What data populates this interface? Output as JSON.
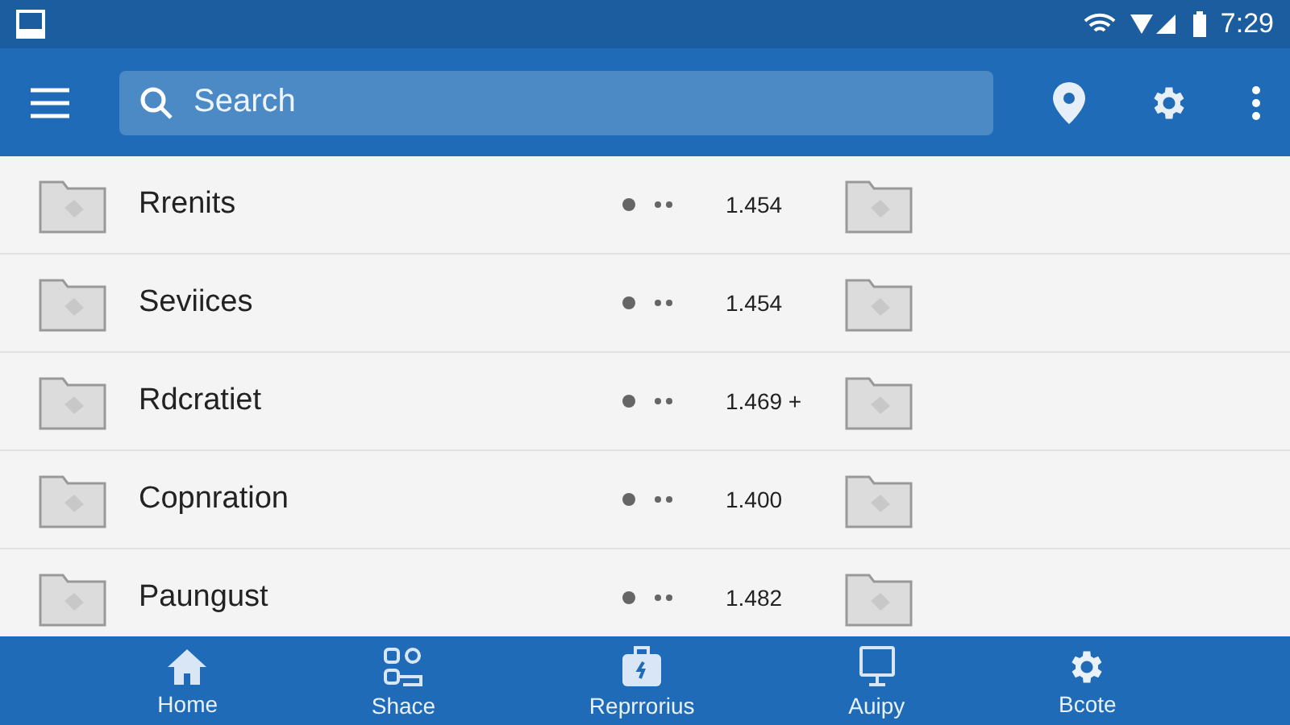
{
  "status_bar": {
    "time": "7:29"
  },
  "app_bar": {
    "search": {
      "placeholder": "Search"
    }
  },
  "rows": [
    {
      "name": "Rrenits",
      "number": "1.454"
    },
    {
      "name": "Seviices",
      "number": "1.454"
    },
    {
      "name": "Rdcratiet",
      "number": "1.469",
      "extra": "+"
    },
    {
      "name": "Copnration",
      "number": "1.400"
    },
    {
      "name": "Paungust",
      "number": "1.482"
    }
  ],
  "bottom_nav": [
    {
      "label": "Home"
    },
    {
      "label": "Shace"
    },
    {
      "label": "Reprrorius"
    },
    {
      "label": "Auipy"
    },
    {
      "label": "Bcote"
    }
  ]
}
